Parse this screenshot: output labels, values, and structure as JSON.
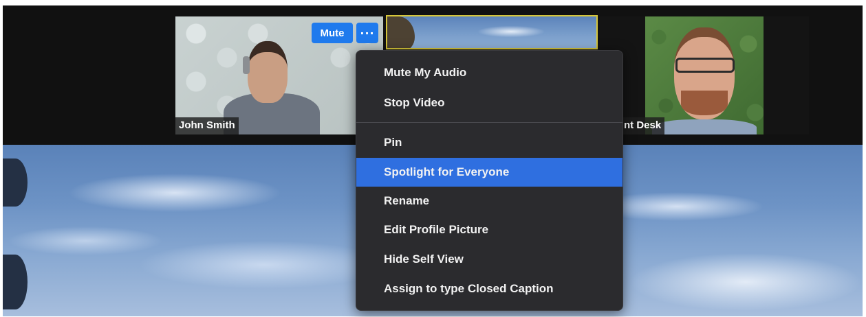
{
  "participants": {
    "john": {
      "name": "John Smith"
    },
    "front_desk": {
      "name": "nt Desk"
    }
  },
  "video_controls": {
    "mute_label": "Mute",
    "more_label": "···"
  },
  "context_menu": {
    "items": [
      {
        "label": "Mute My Audio"
      },
      {
        "label": "Stop Video"
      },
      {
        "label": "Pin"
      },
      {
        "label": "Spotlight for Everyone",
        "highlighted": true
      },
      {
        "label": "Rename"
      },
      {
        "label": "Edit Profile Picture"
      },
      {
        "label": "Hide Self View"
      },
      {
        "label": "Assign to type Closed Caption"
      }
    ]
  },
  "colors": {
    "accent_blue": "#1f7aed",
    "menu_highlight": "#2f6fe0",
    "menu_background": "#2b2b2e",
    "active_speaker_border": "#d6c63a"
  },
  "icons": {
    "more_options": "more-options-icon"
  }
}
